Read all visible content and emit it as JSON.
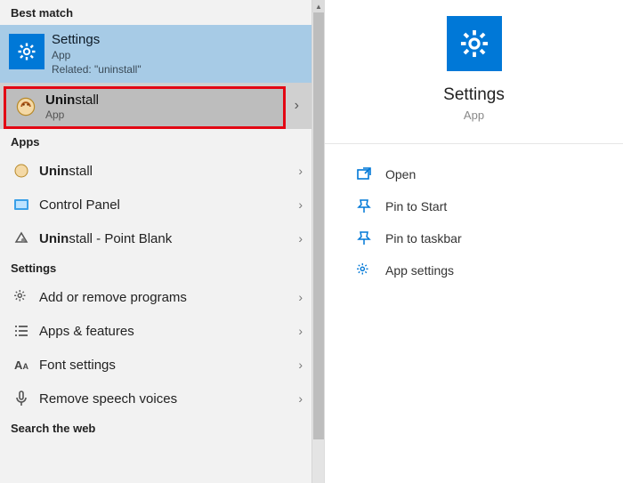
{
  "left": {
    "bestMatchHeader": "Best match",
    "bestMatch": {
      "title": "Settings",
      "sub": "App",
      "related": "Related: \"uninstall\""
    },
    "highlighted": {
      "title": "Uninstall",
      "sub": "App"
    },
    "appsHeader": "Apps",
    "apps": [
      {
        "label": "Uninstall"
      },
      {
        "label": "Control Panel"
      },
      {
        "label": "Uninstall - Point Blank"
      }
    ],
    "settingsHeader": "Settings",
    "settings": [
      {
        "label": "Add or remove programs"
      },
      {
        "label": "Apps & features"
      },
      {
        "label": "Font settings"
      },
      {
        "label": "Remove speech voices"
      }
    ],
    "webHeader": "Search the web"
  },
  "right": {
    "title": "Settings",
    "sub": "App",
    "actions": [
      {
        "label": "Open"
      },
      {
        "label": "Pin to Start"
      },
      {
        "label": "Pin to taskbar"
      },
      {
        "label": "App settings"
      }
    ]
  }
}
